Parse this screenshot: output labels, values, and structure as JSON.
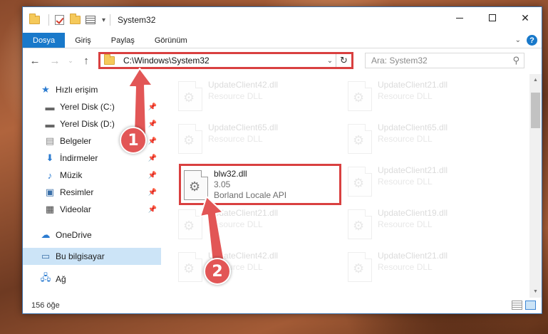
{
  "window": {
    "title": "System32",
    "controls": {
      "minimize": "",
      "maximize": "",
      "close": "✕"
    }
  },
  "ribbon": {
    "tabs": [
      "Dosya",
      "Giriş",
      "Paylaş",
      "Görünüm"
    ],
    "help": "?"
  },
  "navbar": {
    "address": "C:\\Windows\\System32",
    "search_placeholder": "Ara: System32"
  },
  "sidebar": {
    "quick_access": "Hızlı erişim",
    "pinned": [
      "Yerel Disk (C:)",
      "Yerel Disk (D:)",
      "Belgeler",
      "İndirmeler",
      "Müzik",
      "Resimler",
      "Videolar"
    ],
    "onedrive": "OneDrive",
    "this_pc": "Bu bilgisayar",
    "network": "Ağ"
  },
  "files": {
    "left": [
      {
        "name": "UpdateClient42.dll",
        "sub": "Resource DLL"
      },
      {
        "name": "UpdateClient65.dll",
        "sub": "Resource DLL"
      },
      {
        "name": "blw32.dll",
        "version": "3.05",
        "sub": "Borland Locale API"
      },
      {
        "name": "UpdateClient21.dll",
        "sub": "Resource DLL"
      },
      {
        "name": "UpdateClient42.dll",
        "sub": "Resource DLL"
      }
    ],
    "right": [
      {
        "name": "UpdateClient21.dll",
        "sub": "Resource DLL"
      },
      {
        "name": "UpdateClient65.dll",
        "sub": "Resource DLL"
      },
      {
        "name": "UpdateClient21.dll",
        "sub": "Resource DLL"
      },
      {
        "name": "UpdateClient19.dll",
        "sub": "Resource DLL"
      },
      {
        "name": "UpdateClient21.dll",
        "sub": "Resource DLL"
      }
    ]
  },
  "status": {
    "count": "156 öğe"
  },
  "annotations": {
    "step1": "1",
    "step2": "2",
    "color": "#e25656"
  }
}
